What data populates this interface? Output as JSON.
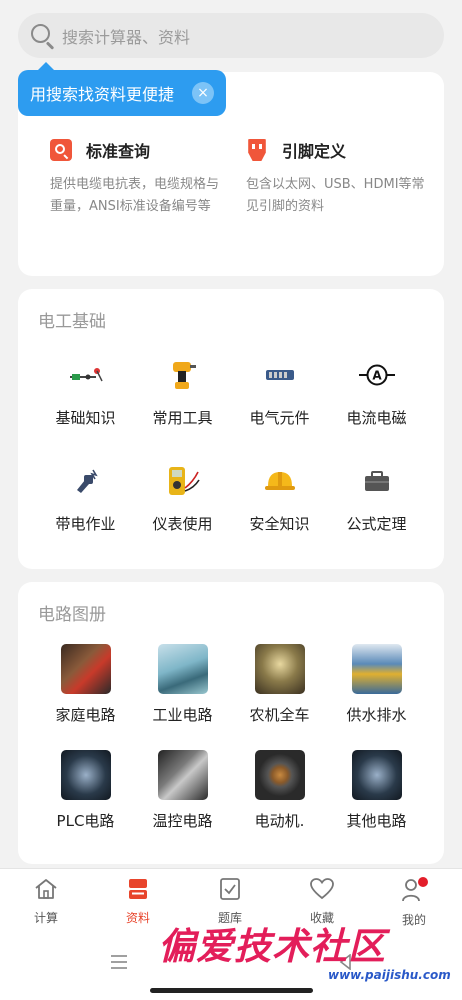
{
  "search": {
    "placeholder": "搜索计算器、资料"
  },
  "tooltip": {
    "text": "用搜索找资料更便捷",
    "close": "×"
  },
  "features": [
    {
      "title": "标准查询",
      "desc": "提供电缆电抗表，电缆规格与重量，ANSI标准设备编号等"
    },
    {
      "title": "引脚定义",
      "desc": "包含以太网、USB、HDMI等常见引脚的资料"
    }
  ],
  "electrical_basics": {
    "title": "电工基础",
    "items": [
      {
        "label": "基础知识",
        "icon": "basics-icon"
      },
      {
        "label": "常用工具",
        "icon": "drill-icon"
      },
      {
        "label": "电气元件",
        "icon": "component-icon"
      },
      {
        "label": "电流电磁",
        "icon": "ammeter-icon"
      },
      {
        "label": "带电作业",
        "icon": "live-work-icon"
      },
      {
        "label": "仪表使用",
        "icon": "multimeter-icon"
      },
      {
        "label": "安全知识",
        "icon": "helmet-icon"
      },
      {
        "label": "公式定理",
        "icon": "toolbox-icon"
      }
    ]
  },
  "circuit_album": {
    "title": "电路图册",
    "items": [
      {
        "label": "家庭电路",
        "color": "#5a3a2a"
      },
      {
        "label": "工业电路",
        "color": "#7fb6c8"
      },
      {
        "label": "农机全车",
        "color": "#6b5a3a"
      },
      {
        "label": "供水排水",
        "color": "#5a8ab8"
      },
      {
        "label": "PLC电路",
        "color": "#2a3a4a"
      },
      {
        "label": "温控电路",
        "color": "#4a4a4a"
      },
      {
        "label": "电动机.",
        "color": "#333333"
      },
      {
        "label": "其他电路",
        "color": "#2a3a4a"
      }
    ]
  },
  "tabs": [
    {
      "label": "计算",
      "icon": "home-icon"
    },
    {
      "label": "资料",
      "icon": "materials-icon"
    },
    {
      "label": "题库",
      "icon": "question-bank-icon"
    },
    {
      "label": "收藏",
      "icon": "heart-icon"
    },
    {
      "label": "我的",
      "icon": "profile-icon"
    }
  ],
  "watermark": {
    "text": "偏爱技术社区",
    "url": "www.paijishu.com"
  },
  "colors": {
    "accent": "#e8452c",
    "tooltip": "#2d9cf0"
  }
}
